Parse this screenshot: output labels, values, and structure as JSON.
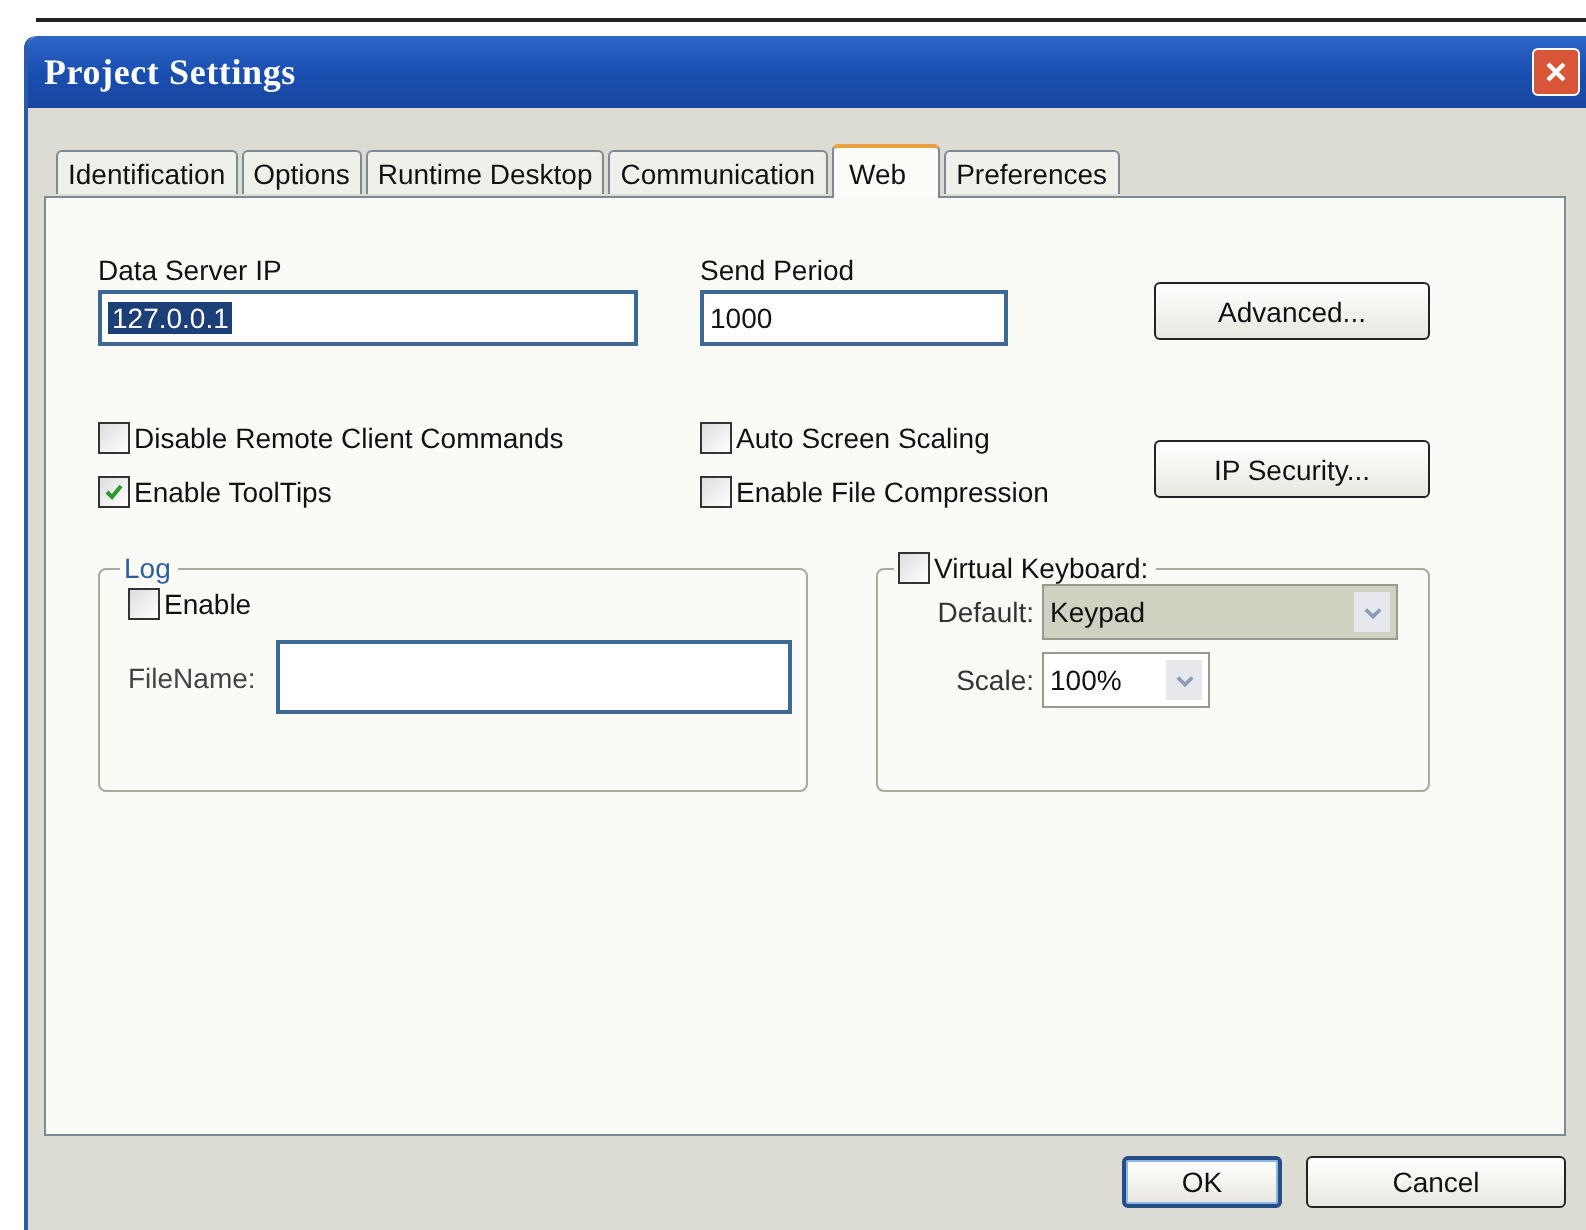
{
  "window": {
    "title": "Project Settings"
  },
  "tabs": [
    {
      "label": "Identification",
      "selected": false
    },
    {
      "label": "Options",
      "selected": false
    },
    {
      "label": "Runtime Desktop",
      "selected": false
    },
    {
      "label": "Communication",
      "selected": false
    },
    {
      "label": "Web",
      "selected": true
    },
    {
      "label": "Preferences",
      "selected": false
    }
  ],
  "data_server_ip": {
    "label": "Data Server IP",
    "value": "127.0.0.1",
    "highlighted": true
  },
  "send_period": {
    "label": "Send Period",
    "value": "1000",
    "highlighted": false
  },
  "options": [
    {
      "label": "Disable Remote Client Commands",
      "checked": false
    },
    {
      "label": "Enable ToolTips",
      "checked": true
    },
    {
      "label": "Auto Screen Scaling",
      "checked": false
    },
    {
      "label": "Enable File Compression",
      "checked": false
    }
  ],
  "side_buttons": [
    "Advanced...",
    "IP Security..."
  ],
  "log": {
    "title": "Log",
    "enable": {
      "label": "Enable",
      "checked": false
    },
    "filename": {
      "label": "FileName:"
    }
  },
  "virtual_keyboard": {
    "label": "Virtual Keyboard:",
    "checked": false,
    "default": {
      "label": "Default:",
      "value": "Keypad",
      "disabled": true
    },
    "scale": {
      "label": "Scale:",
      "value": "100%",
      "disabled": false
    }
  },
  "buttons": [
    {
      "label": "OK",
      "default": true
    },
    {
      "label": "Cancel",
      "default": false
    }
  ]
}
